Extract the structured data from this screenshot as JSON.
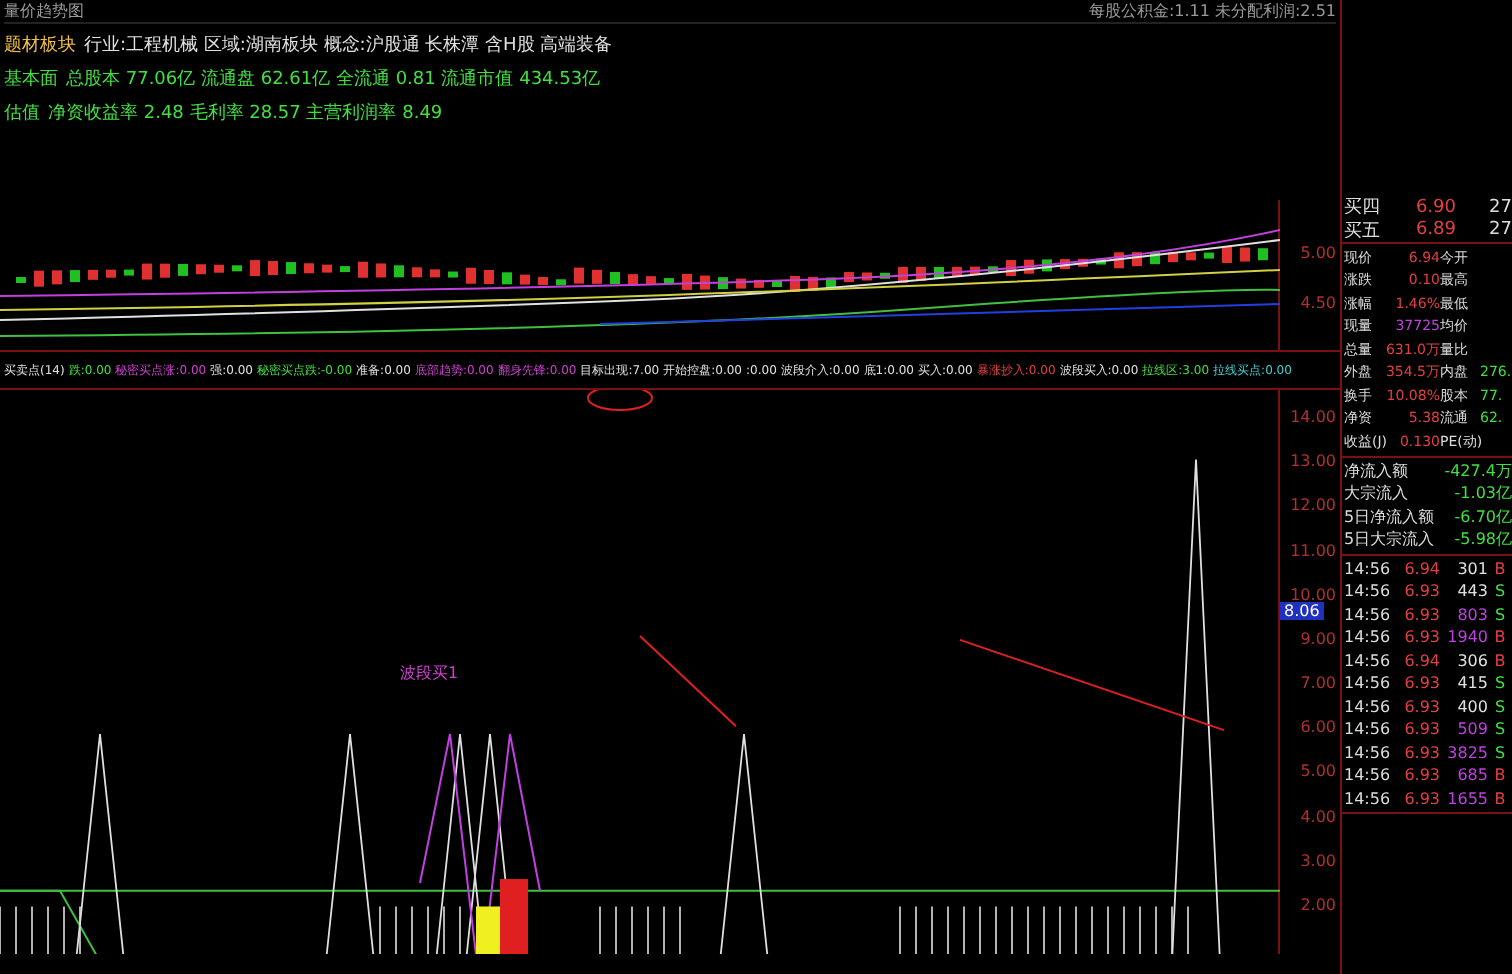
{
  "header": {
    "top_left": "量价趋势图",
    "top_right": "每股公积金:1.11 未分配利润:2.51",
    "lines": [
      {
        "label": "题材板块",
        "text": "行业:工程机械 区域:湖南板块 概念:沪股通 长株潭 含H股 高端装备"
      },
      {
        "label": "基本面",
        "text": "总股本 77.06亿 流通盘 62.61亿 全流通 0.81 流通市值 434.53亿"
      },
      {
        "label": "估值",
        "text": "净资收益率 2.48 毛利率 28.57 主营利润率 8.49"
      }
    ]
  },
  "price_axis": [
    "5.00",
    "4.50"
  ],
  "indicator": {
    "labels": [
      {
        "text": "买卖点(14)",
        "color": "#e0e0e0"
      },
      {
        "text": "跌:0.00",
        "color": "#40e040"
      },
      {
        "text": "秘密买点涨:0.00",
        "color": "#d040d0"
      },
      {
        "text": "强:0.00",
        "color": "#e0e0e0"
      },
      {
        "text": "秘密买点跌:-0.00",
        "color": "#40e040"
      },
      {
        "text": "准备:0.00",
        "color": "#e0e0e0"
      },
      {
        "text": "底部趋势:0.00",
        "color": "#d040d0"
      },
      {
        "text": "翻身先锋:0.00",
        "color": "#d040d0"
      },
      {
        "text": "目标出现:7.00",
        "color": "#e0e0e0"
      },
      {
        "text": "开始控盘:0.00",
        "color": "#e0e0e0"
      },
      {
        "text": ":0.00",
        "color": "#e0e0e0"
      },
      {
        "text": "波段介入:0.00",
        "color": "#e0e0e0"
      },
      {
        "text": "底1:0.00",
        "color": "#e0e0e0"
      },
      {
        "text": "买入:0.00",
        "color": "#e0e0e0"
      },
      {
        "text": "暴涨抄入:0.00",
        "color": "#e04040"
      },
      {
        "text": "波段买入:0.00",
        "color": "#e0e0e0"
      },
      {
        "text": "拉线区:3.00",
        "color": "#40e040"
      },
      {
        "text": "拉线买点:0.00",
        "color": "#40d0d0"
      }
    ],
    "axis": [
      "14.00",
      "13.00",
      "12.00",
      "11.00",
      "10.00",
      "9.00",
      "7.00",
      "6.00",
      "5.00",
      "4.00",
      "3.00",
      "2.00"
    ],
    "cursor_value": "8.06",
    "chart_label": "波段买1"
  },
  "order_book": [
    {
      "label": "买四",
      "price": "6.90",
      "volume": "27"
    },
    {
      "label": "买五",
      "price": "6.89",
      "volume": "27"
    }
  ],
  "quote": [
    {
      "l1": "现价",
      "v1": "6.94",
      "l2": "今开"
    },
    {
      "l1": "涨跌",
      "v1": "0.10",
      "l2": "最高"
    },
    {
      "l1": "涨幅",
      "v1": "1.46%",
      "l2": "最低"
    },
    {
      "l1": "现量",
      "v1": "37725",
      "l2": "均价"
    },
    {
      "l1": "总量",
      "v1": "631.0万",
      "l2": "量比"
    },
    {
      "l1": "外盘",
      "v1": "354.5万",
      "l2": "内盘",
      "v2": "276."
    },
    {
      "l1": "换手",
      "v1": "10.08%",
      "l2": "股本",
      "v2": "77."
    },
    {
      "l1": "净资",
      "v1": "5.38",
      "l2": "流通",
      "v2": "62."
    },
    {
      "l1": "收益(J)",
      "v1": "0.130",
      "l2": "PE(动)"
    }
  ],
  "flows": [
    {
      "label": "净流入额",
      "value": "-427.4万"
    },
    {
      "label": "大宗流入",
      "value": "-1.03亿"
    },
    {
      "label": "5日净流入额",
      "value": "-6.70亿"
    },
    {
      "label": "5日大宗流入",
      "value": "-5.98亿"
    }
  ],
  "ticks": [
    {
      "time": "14:56",
      "price": "6.94",
      "volume": "301",
      "side": "B",
      "kind": "buy",
      "color": "#e0e0e0"
    },
    {
      "time": "14:56",
      "price": "6.93",
      "volume": "443",
      "side": "S",
      "kind": "sell",
      "color": "#e0e0e0"
    },
    {
      "time": "14:56",
      "price": "6.93",
      "volume": "803",
      "side": "S",
      "kind": "sell",
      "color": "#c040e0"
    },
    {
      "time": "14:56",
      "price": "6.93",
      "volume": "1940",
      "side": "B",
      "kind": "buy",
      "color": "#c040e0"
    },
    {
      "time": "14:56",
      "price": "6.94",
      "volume": "306",
      "side": "B",
      "kind": "buy",
      "color": "#e0e0e0"
    },
    {
      "time": "14:56",
      "price": "6.93",
      "volume": "415",
      "side": "S",
      "kind": "sell",
      "color": "#e0e0e0"
    },
    {
      "time": "14:56",
      "price": "6.93",
      "volume": "400",
      "side": "S",
      "kind": "sell",
      "color": "#e0e0e0"
    },
    {
      "time": "14:56",
      "price": "6.93",
      "volume": "509",
      "side": "S",
      "kind": "sell",
      "color": "#c040e0"
    },
    {
      "time": "14:56",
      "price": "6.93",
      "volume": "3825",
      "side": "S",
      "kind": "sell",
      "color": "#c040e0"
    },
    {
      "time": "14:56",
      "price": "6.93",
      "volume": "685",
      "side": "B",
      "kind": "buy",
      "color": "#c040e0"
    },
    {
      "time": "14:56",
      "price": "6.93",
      "volume": "1655",
      "side": "B",
      "kind": "buy",
      "color": "#c040e0"
    }
  ]
}
